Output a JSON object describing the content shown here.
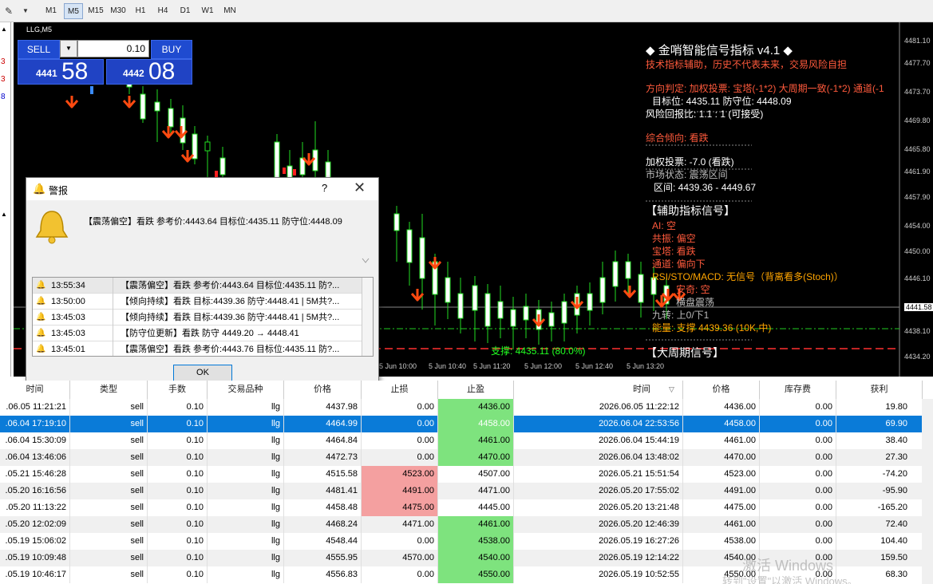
{
  "toolbar": {
    "timeframes": [
      "M1",
      "M5",
      "M15",
      "M30",
      "H1",
      "H4",
      "D1",
      "W1",
      "MN"
    ],
    "active": "M5"
  },
  "left_panel": {
    "digits": [
      "3",
      "3",
      "8"
    ]
  },
  "chart": {
    "title": "LLG,M5",
    "trade": {
      "sell_label": "SELL",
      "buy_label": "BUY",
      "lot": "0.10",
      "bid_small": "4441",
      "bid_big": "58",
      "ask_small": "4442",
      "ask_big": "08"
    },
    "y_ticks": [
      "4481.10",
      "4477.70",
      "4473.70",
      "4469.80",
      "4465.80",
      "4461.90",
      "4457.90",
      "4454.00",
      "4450.00",
      "4446.10",
      "4441.58",
      "4438.10",
      "4434.20"
    ],
    "x_ticks": [
      "5 Jun 10:00",
      "5 Jun 10:40",
      "5 Jun 11:20",
      "5 Jun 12:00",
      "5 Jun 12:40",
      "5 Jun 13:20"
    ],
    "support_label": "支撑: 4435.11 (80.0%)",
    "indicator": {
      "title": "◆ 金哨智能信号指标 v4.1 ◆",
      "disclaimer": "技术指标辅助，历史不代表未来，交易风险自担",
      "direction": "方向判定: 加权投票: 宝塔(-1*2) 大周期一致(-1*2) 通道(-1",
      "target": "目标位: 4435.11  防守位: 4448.09",
      "rr": "风险回报比: 1.1 : 1 (可接受)",
      "bias": "综合倾向: 看跌",
      "vote": "加权投票: -7.0 (看跌)",
      "market": "市场状态: 震荡区间",
      "range": "区间: 4439.36 - 4449.67",
      "aux_title": "【辅助指标信号】",
      "ai": "AI: 空",
      "resonance": "共振: 偏空",
      "tower": "宝塔: 看跌",
      "channel": "通道: 偏向下",
      "rsi": "RSI/STO/MACD: 无信号（背离看多(Stoch)）",
      "anqi": "安奇: 空",
      "horiz": "横盘震荡",
      "nine": "九转: 上0/下1",
      "energy": "能量: 支撑 4439.36 (10K,中)",
      "big_title": "【大周期信号】"
    }
  },
  "dialog": {
    "title": "警报",
    "help": "?",
    "message": "【震荡偏空】看跌 参考价:4443.64 目标位:4435.11 防守位:4448.09",
    "rows": [
      {
        "time": "13:55:34",
        "text": "【震荡偏空】看跌 参考价:4443.64 目标位:4435.11 防?..."
      },
      {
        "time": "13:50:00",
        "text": "【倾向持续】看跌 目标:4439.36 防守:4448.41 | 5M共?..."
      },
      {
        "time": "13:45:03",
        "text": "【倾向持续】看跌 目标:4439.36 防守:4448.41 | 5M共?..."
      },
      {
        "time": "13:45:03",
        "text": "【防守位更新】看跌 防守 4449.20 → 4448.41"
      },
      {
        "time": "13:45:01",
        "text": "【震荡偏空】看跌 参考价:4443.76 目标位:4435.11 防?..."
      }
    ],
    "ok": "OK"
  },
  "table": {
    "headers": [
      "时间",
      "类型",
      "手数",
      "交易品种",
      "价格",
      "止损",
      "止盈",
      "时间",
      "价格",
      "库存费",
      "获利"
    ],
    "sort_icon": "▽",
    "rows": [
      {
        "t1": ".06.05 11:21:21",
        "type": "sell",
        "lots": "0.10",
        "sym": "llg",
        "price": "4437.98",
        "sl": "0.00",
        "tp": "4436.00",
        "t2": "2026.06.05 11:22:12",
        "p2": "4436.00",
        "swap": "0.00",
        "profit": "19.80",
        "tpg": true,
        "slr": false
      },
      {
        "t1": ".06.04 17:19:10",
        "type": "sell",
        "lots": "0.10",
        "sym": "llg",
        "price": "4464.99",
        "sl": "0.00",
        "tp": "4458.00",
        "t2": "2026.06.04 22:53:56",
        "p2": "4458.00",
        "swap": "0.00",
        "profit": "69.90",
        "tpg": true,
        "slr": false
      },
      {
        "t1": ".06.04 15:30:09",
        "type": "sell",
        "lots": "0.10",
        "sym": "llg",
        "price": "4464.84",
        "sl": "0.00",
        "tp": "4461.00",
        "t2": "2026.06.04 15:44:19",
        "p2": "4461.00",
        "swap": "0.00",
        "profit": "38.40",
        "tpg": true,
        "slr": false
      },
      {
        "t1": ".06.04 13:46:06",
        "type": "sell",
        "lots": "0.10",
        "sym": "llg",
        "price": "4472.73",
        "sl": "0.00",
        "tp": "4470.00",
        "t2": "2026.06.04 13:48:02",
        "p2": "4470.00",
        "swap": "0.00",
        "profit": "27.30",
        "tpg": true,
        "slr": false
      },
      {
        "t1": ".05.21 15:46:28",
        "type": "sell",
        "lots": "0.10",
        "sym": "llg",
        "price": "4515.58",
        "sl": "4523.00",
        "tp": "4507.00",
        "t2": "2026.05.21 15:51:54",
        "p2": "4523.00",
        "swap": "0.00",
        "profit": "-74.20",
        "tpg": false,
        "slr": true
      },
      {
        "t1": ".05.20 16:16:56",
        "type": "sell",
        "lots": "0.10",
        "sym": "llg",
        "price": "4481.41",
        "sl": "4491.00",
        "tp": "4471.00",
        "t2": "2026.05.20 17:55:02",
        "p2": "4491.00",
        "swap": "0.00",
        "profit": "-95.90",
        "tpg": false,
        "slr": true
      },
      {
        "t1": ".05.20 11:13:22",
        "type": "sell",
        "lots": "0.10",
        "sym": "llg",
        "price": "4458.48",
        "sl": "4475.00",
        "tp": "4445.00",
        "t2": "2026.05.20 13:21:48",
        "p2": "4475.00",
        "swap": "0.00",
        "profit": "-165.20",
        "tpg": false,
        "slr": true
      },
      {
        "t1": ".05.20 12:02:09",
        "type": "sell",
        "lots": "0.10",
        "sym": "llg",
        "price": "4468.24",
        "sl": "4471.00",
        "tp": "4461.00",
        "t2": "2026.05.20 12:46:39",
        "p2": "4461.00",
        "swap": "0.00",
        "profit": "72.40",
        "tpg": true,
        "slr": false
      },
      {
        "t1": ".05.19 15:06:02",
        "type": "sell",
        "lots": "0.10",
        "sym": "llg",
        "price": "4548.44",
        "sl": "0.00",
        "tp": "4538.00",
        "t2": "2026.05.19 16:27:26",
        "p2": "4538.00",
        "swap": "0.00",
        "profit": "104.40",
        "tpg": true,
        "slr": false
      },
      {
        "t1": ".05.19 10:09:48",
        "type": "sell",
        "lots": "0.10",
        "sym": "llg",
        "price": "4555.95",
        "sl": "4570.00",
        "tp": "4540.00",
        "t2": "2026.05.19 12:14:22",
        "p2": "4540.00",
        "swap": "0.00",
        "profit": "159.50",
        "tpg": true,
        "slr": false
      },
      {
        "t1": ".05.19 10:46:17",
        "type": "sell",
        "lots": "0.10",
        "sym": "llg",
        "price": "4556.83",
        "sl": "0.00",
        "tp": "4550.00",
        "t2": "2026.05.19 10:52:55",
        "p2": "4550.00",
        "swap": "0.00",
        "profit": "68.30",
        "tpg": true,
        "slr": false
      }
    ]
  },
  "watermark": {
    "line1": "激活 Windows",
    "line2": "转到\"设置\"以激活 Windows。"
  }
}
